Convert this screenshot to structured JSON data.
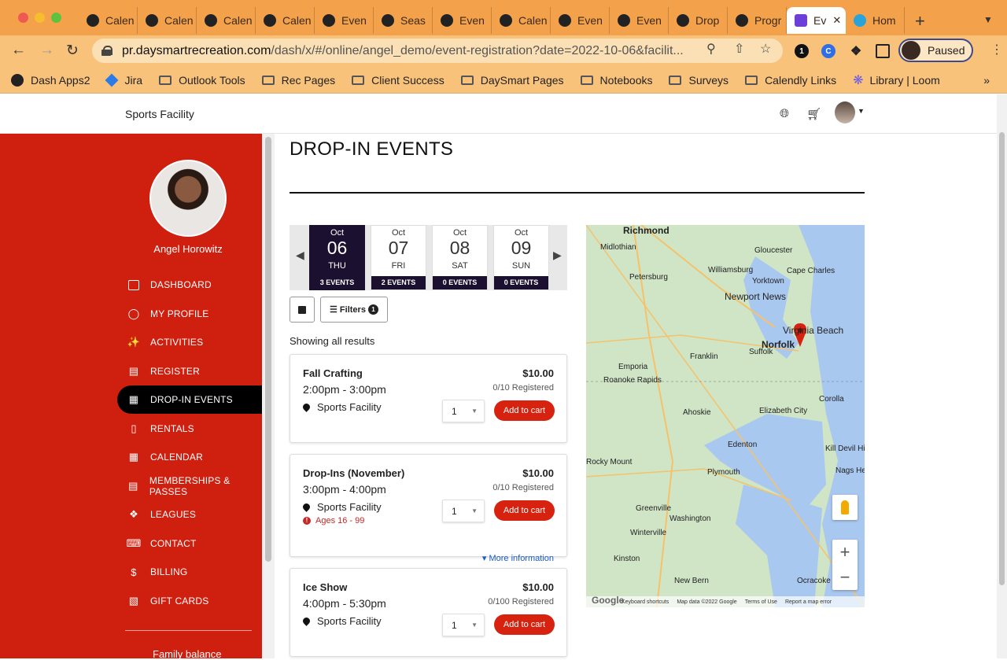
{
  "browser": {
    "tabs": [
      {
        "label": "Calen",
        "active": false
      },
      {
        "label": "Calen",
        "active": false
      },
      {
        "label": "Calen",
        "active": false
      },
      {
        "label": "Calen",
        "active": false
      },
      {
        "label": "Even",
        "active": false
      },
      {
        "label": "Seas",
        "active": false
      },
      {
        "label": "Even",
        "active": false
      },
      {
        "label": "Calen",
        "active": false
      },
      {
        "label": "Even",
        "active": false
      },
      {
        "label": "Even",
        "active": false
      },
      {
        "label": "Drop",
        "active": false
      },
      {
        "label": "Progr",
        "active": false
      },
      {
        "label": "Ev",
        "active": true
      },
      {
        "label": "Hom",
        "active": false
      }
    ],
    "url_host": "pr.daysmartrecreation.com",
    "url_path": "/dash/x/#/online/angel_demo/event-registration?date=2022-10-06&facilit...",
    "profile_label": "Paused",
    "bookmarks": [
      {
        "label": "Dash Apps2",
        "icon": "circle"
      },
      {
        "label": "Jira",
        "icon": "jira-diamond"
      },
      {
        "label": "Outlook Tools",
        "icon": "folder"
      },
      {
        "label": "Rec Pages",
        "icon": "folder"
      },
      {
        "label": "Client Success",
        "icon": "folder"
      },
      {
        "label": "DaySmart Pages",
        "icon": "folder"
      },
      {
        "label": "Notebooks",
        "icon": "folder"
      },
      {
        "label": "Surveys",
        "icon": "folder"
      },
      {
        "label": "Calendly Links",
        "icon": "folder"
      },
      {
        "label": "Library | Loom",
        "icon": "loom-star"
      }
    ],
    "bookmarks_more": "»"
  },
  "header": {
    "facility": "Sports Facility"
  },
  "sidebar": {
    "user_name": "Angel Horowitz",
    "items": [
      {
        "label": "DASHBOARD",
        "icon": "book-icon",
        "active": false
      },
      {
        "label": "MY PROFILE",
        "icon": "user-circle-icon",
        "active": false
      },
      {
        "label": "ACTIVITIES",
        "icon": "running-icon",
        "active": false
      },
      {
        "label": "REGISTER",
        "icon": "list-icon",
        "active": false
      },
      {
        "label": "DROP-IN EVENTS",
        "icon": "calendar-icon",
        "active": true
      },
      {
        "label": "RENTALS",
        "icon": "bookmark-icon",
        "active": false
      },
      {
        "label": "CALENDAR",
        "icon": "calendar-grid-icon",
        "active": false
      },
      {
        "label": "MEMBERSHIPS & PASSES",
        "icon": "id-card-icon",
        "active": false
      },
      {
        "label": "LEAGUES",
        "icon": "medal-icon",
        "active": false
      },
      {
        "label": "CONTACT",
        "icon": "keyboard-icon",
        "active": false
      },
      {
        "label": "BILLING",
        "icon": "dollar-icon",
        "active": false
      },
      {
        "label": "GIFT CARDS",
        "icon": "gift-icon",
        "active": false
      }
    ],
    "family_balance_label": "Family balance"
  },
  "main": {
    "title": "DROP-IN EVENTS",
    "dates": [
      {
        "month": "Oct",
        "day": "06",
        "dow": "THU",
        "count": "3 EVENTS",
        "selected": true
      },
      {
        "month": "Oct",
        "day": "07",
        "dow": "FRI",
        "count": "2 EVENTS",
        "selected": false
      },
      {
        "month": "Oct",
        "day": "08",
        "dow": "SAT",
        "count": "0 EVENTS",
        "selected": false
      },
      {
        "month": "Oct",
        "day": "09",
        "dow": "SUN",
        "count": "0 EVENTS",
        "selected": false
      }
    ],
    "filters_label": "Filters",
    "filters_count": "1",
    "showing": "Showing all results",
    "events": [
      {
        "name": "Fall Crafting",
        "time": "2:00pm - 3:00pm",
        "location": "Sports Facility",
        "price": "$10.00",
        "registered": "0/10 Registered",
        "qty": "1",
        "add_label": "Add to cart",
        "age": "",
        "more": ""
      },
      {
        "name": "Drop-Ins (November)",
        "time": "3:00pm - 4:00pm",
        "location": "Sports Facility",
        "price": "$10.00",
        "registered": "0/10 Registered",
        "qty": "1",
        "add_label": "Add to cart",
        "age": "Ages 16 - 99",
        "more": "More information"
      },
      {
        "name": "Ice Show",
        "time": "4:00pm - 5:30pm",
        "location": "Sports Facility",
        "price": "$10.00",
        "registered": "0/100 Registered",
        "qty": "1",
        "add_label": "Add to cart",
        "age": "",
        "more": ""
      }
    ]
  },
  "map": {
    "places": [
      "Richmond",
      "Midlothian",
      "Gloucester",
      "Petersburg",
      "Williamsburg",
      "Cape Charles",
      "Yorktown",
      "Newport News",
      "Virginia Beach",
      "Norfolk",
      "Franklin",
      "Suffolk",
      "Emporia",
      "Roanoke Rapids",
      "Ahoskie",
      "Elizabeth City",
      "Corolla",
      "Edenton",
      "Kill Devil Hills",
      "Rocky Mount",
      "Plymouth",
      "Nags Head",
      "Greenville",
      "Washington",
      "Winterville",
      "Kinston",
      "New Bern",
      "Ocracoke"
    ],
    "footer": {
      "logo": "Google",
      "shortcuts": "Keyboard shortcuts",
      "data": "Map data ©2022 Google",
      "terms": "Terms of Use",
      "report": "Report a map error"
    }
  },
  "colors": {
    "sidebar": "#cf1f0f",
    "accent_button": "#d7220f",
    "selected_date": "#1c1030",
    "browser_frame": "#f3a14a"
  }
}
